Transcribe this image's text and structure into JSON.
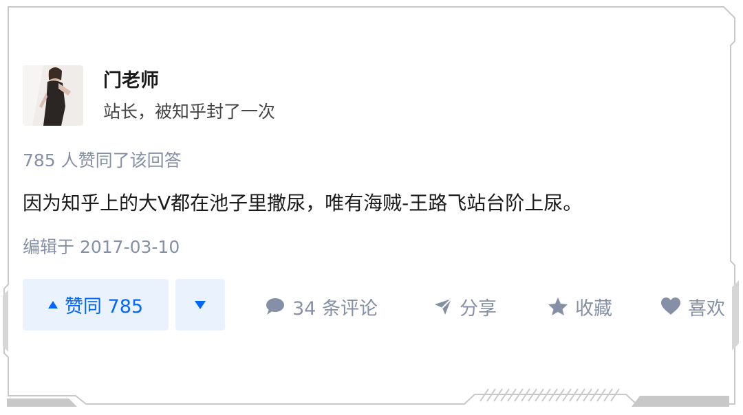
{
  "author": {
    "name": "门老师",
    "bio": "站长，被知乎封了一次"
  },
  "answer": {
    "vote_summary": "785 人赞同了该回答",
    "text": "因为知乎上的大V都在池子里撒尿，唯有海贼-王路飞站台阶上尿。",
    "edited": "编辑于 2017-03-10"
  },
  "actions": {
    "upvote_label": "赞同 785",
    "comments_label": "34 条评论",
    "share_label": "分享",
    "favorite_label": "收藏",
    "like_label": "喜欢"
  },
  "colors": {
    "accent": "#0066ff",
    "vote_bg": "#e9f2fd",
    "muted": "#8590a6",
    "frame": "#c8c8c8"
  },
  "icons": [
    "avatar-image",
    "upvote-triangle-icon",
    "downvote-triangle-icon",
    "comment-bubble-icon",
    "share-plane-icon",
    "star-icon",
    "heart-icon"
  ]
}
